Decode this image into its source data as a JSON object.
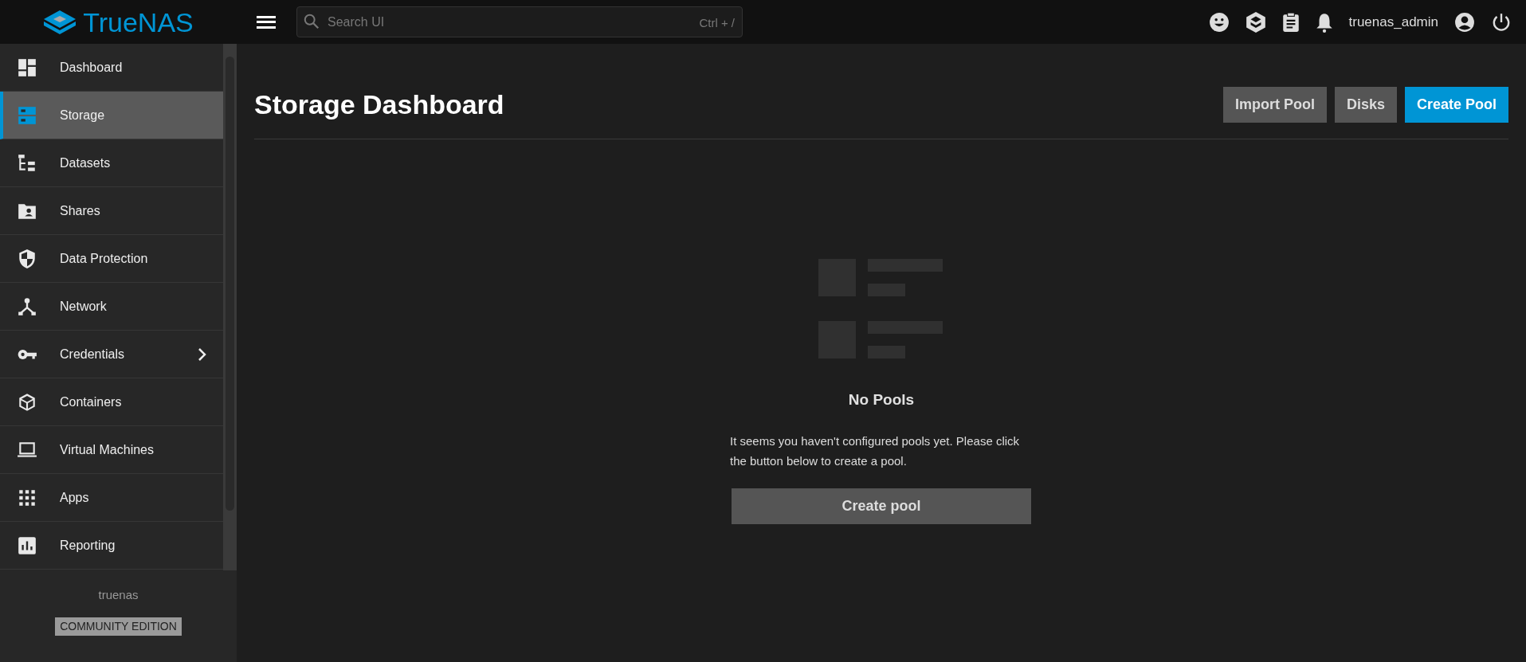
{
  "topbar": {
    "logo": "TrueNAS",
    "search": {
      "placeholder": "Search UI",
      "shortcut": "Ctrl + /"
    },
    "username": "truenas_admin"
  },
  "sidebar": {
    "items": [
      {
        "label": "Dashboard",
        "selected": false,
        "expandable": false
      },
      {
        "label": "Storage",
        "selected": true,
        "expandable": false
      },
      {
        "label": "Datasets",
        "selected": false,
        "expandable": false
      },
      {
        "label": "Shares",
        "selected": false,
        "expandable": false
      },
      {
        "label": "Data Protection",
        "selected": false,
        "expandable": false
      },
      {
        "label": "Network",
        "selected": false,
        "expandable": false
      },
      {
        "label": "Credentials",
        "selected": false,
        "expandable": true
      },
      {
        "label": "Containers",
        "selected": false,
        "expandable": false
      },
      {
        "label": "Virtual Machines",
        "selected": false,
        "expandable": false
      },
      {
        "label": "Apps",
        "selected": false,
        "expandable": false
      },
      {
        "label": "Reporting",
        "selected": false,
        "expandable": false
      }
    ],
    "hostname": "truenas",
    "edition": "COMMUNITY EDITION"
  },
  "page": {
    "title": "Storage Dashboard",
    "actions": [
      {
        "label": "Import Pool",
        "kind": "secondary"
      },
      {
        "label": "Disks",
        "kind": "secondary"
      },
      {
        "label": "Create Pool",
        "kind": "primary"
      }
    ],
    "empty_state": {
      "title": "No Pools",
      "message": "It seems you haven't configured pools yet. Please click the button below to create a pool.",
      "button": "Create pool"
    }
  }
}
